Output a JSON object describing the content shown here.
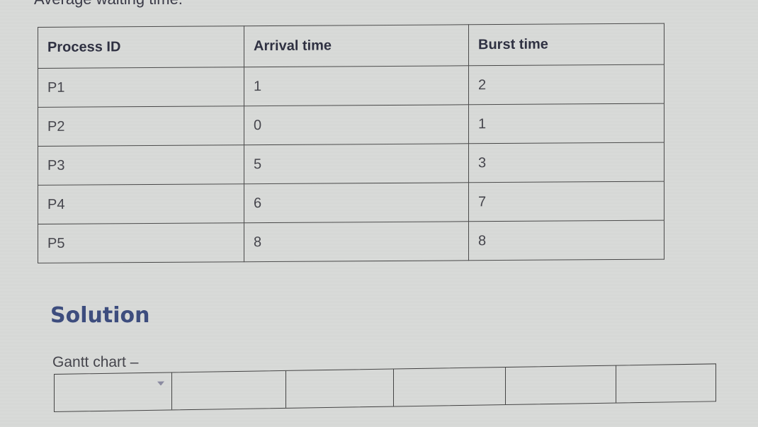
{
  "previous_text": "Average waiting time.",
  "process_table": {
    "headers": [
      "Process ID",
      "Arrival time",
      "Burst time"
    ],
    "rows": [
      [
        "P1",
        "1",
        "2"
      ],
      [
        "P2",
        "0",
        "1"
      ],
      [
        "P3",
        "5",
        "3"
      ],
      [
        "P4",
        "6",
        "7"
      ],
      [
        "P5",
        "8",
        "8"
      ]
    ]
  },
  "solution_heading": "Solution",
  "gantt_label": "Gantt chart –",
  "gantt_cells": [
    "",
    "",
    "",
    "",
    "",
    ""
  ]
}
